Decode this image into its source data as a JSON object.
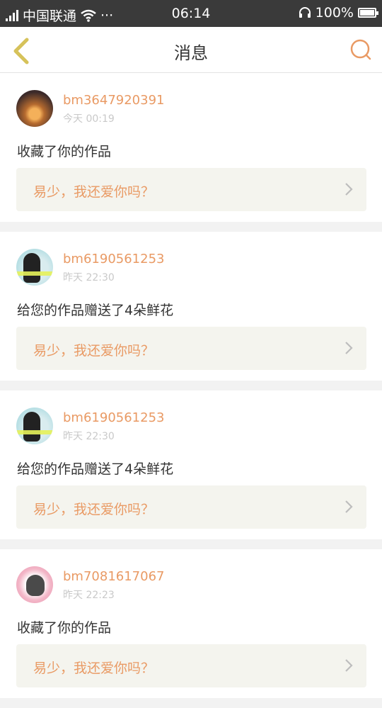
{
  "status_bar": {
    "carrier": "中国联通",
    "dots": "···",
    "time": "06:14",
    "battery": "100%",
    "battery_level": 1.0
  },
  "header": {
    "title": "消息",
    "back_icon": "chevron-left-icon",
    "search_icon": "search-icon"
  },
  "colors": {
    "accent": "#e99a64",
    "back": "#d6c25a",
    "status_bar": "#3a3a3a"
  },
  "messages": [
    {
      "username": "bm3647920391",
      "time": "今天 00:19",
      "text": "收藏了你的作品",
      "work_title": "易少，我还爱你吗？"
    },
    {
      "username": "bm6190561253",
      "time": "昨天 22:30",
      "text": "给您的作品赠送了4朵鲜花",
      "work_title": "易少，我还爱你吗？"
    },
    {
      "username": "bm6190561253",
      "time": "昨天 22:30",
      "text": "给您的作品赠送了4朵鲜花",
      "work_title": "易少，我还爱你吗？"
    },
    {
      "username": "bm7081617067",
      "time": "昨天 22:23",
      "text": "收藏了你的作品",
      "work_title": "易少，我还爱你吗？"
    }
  ]
}
